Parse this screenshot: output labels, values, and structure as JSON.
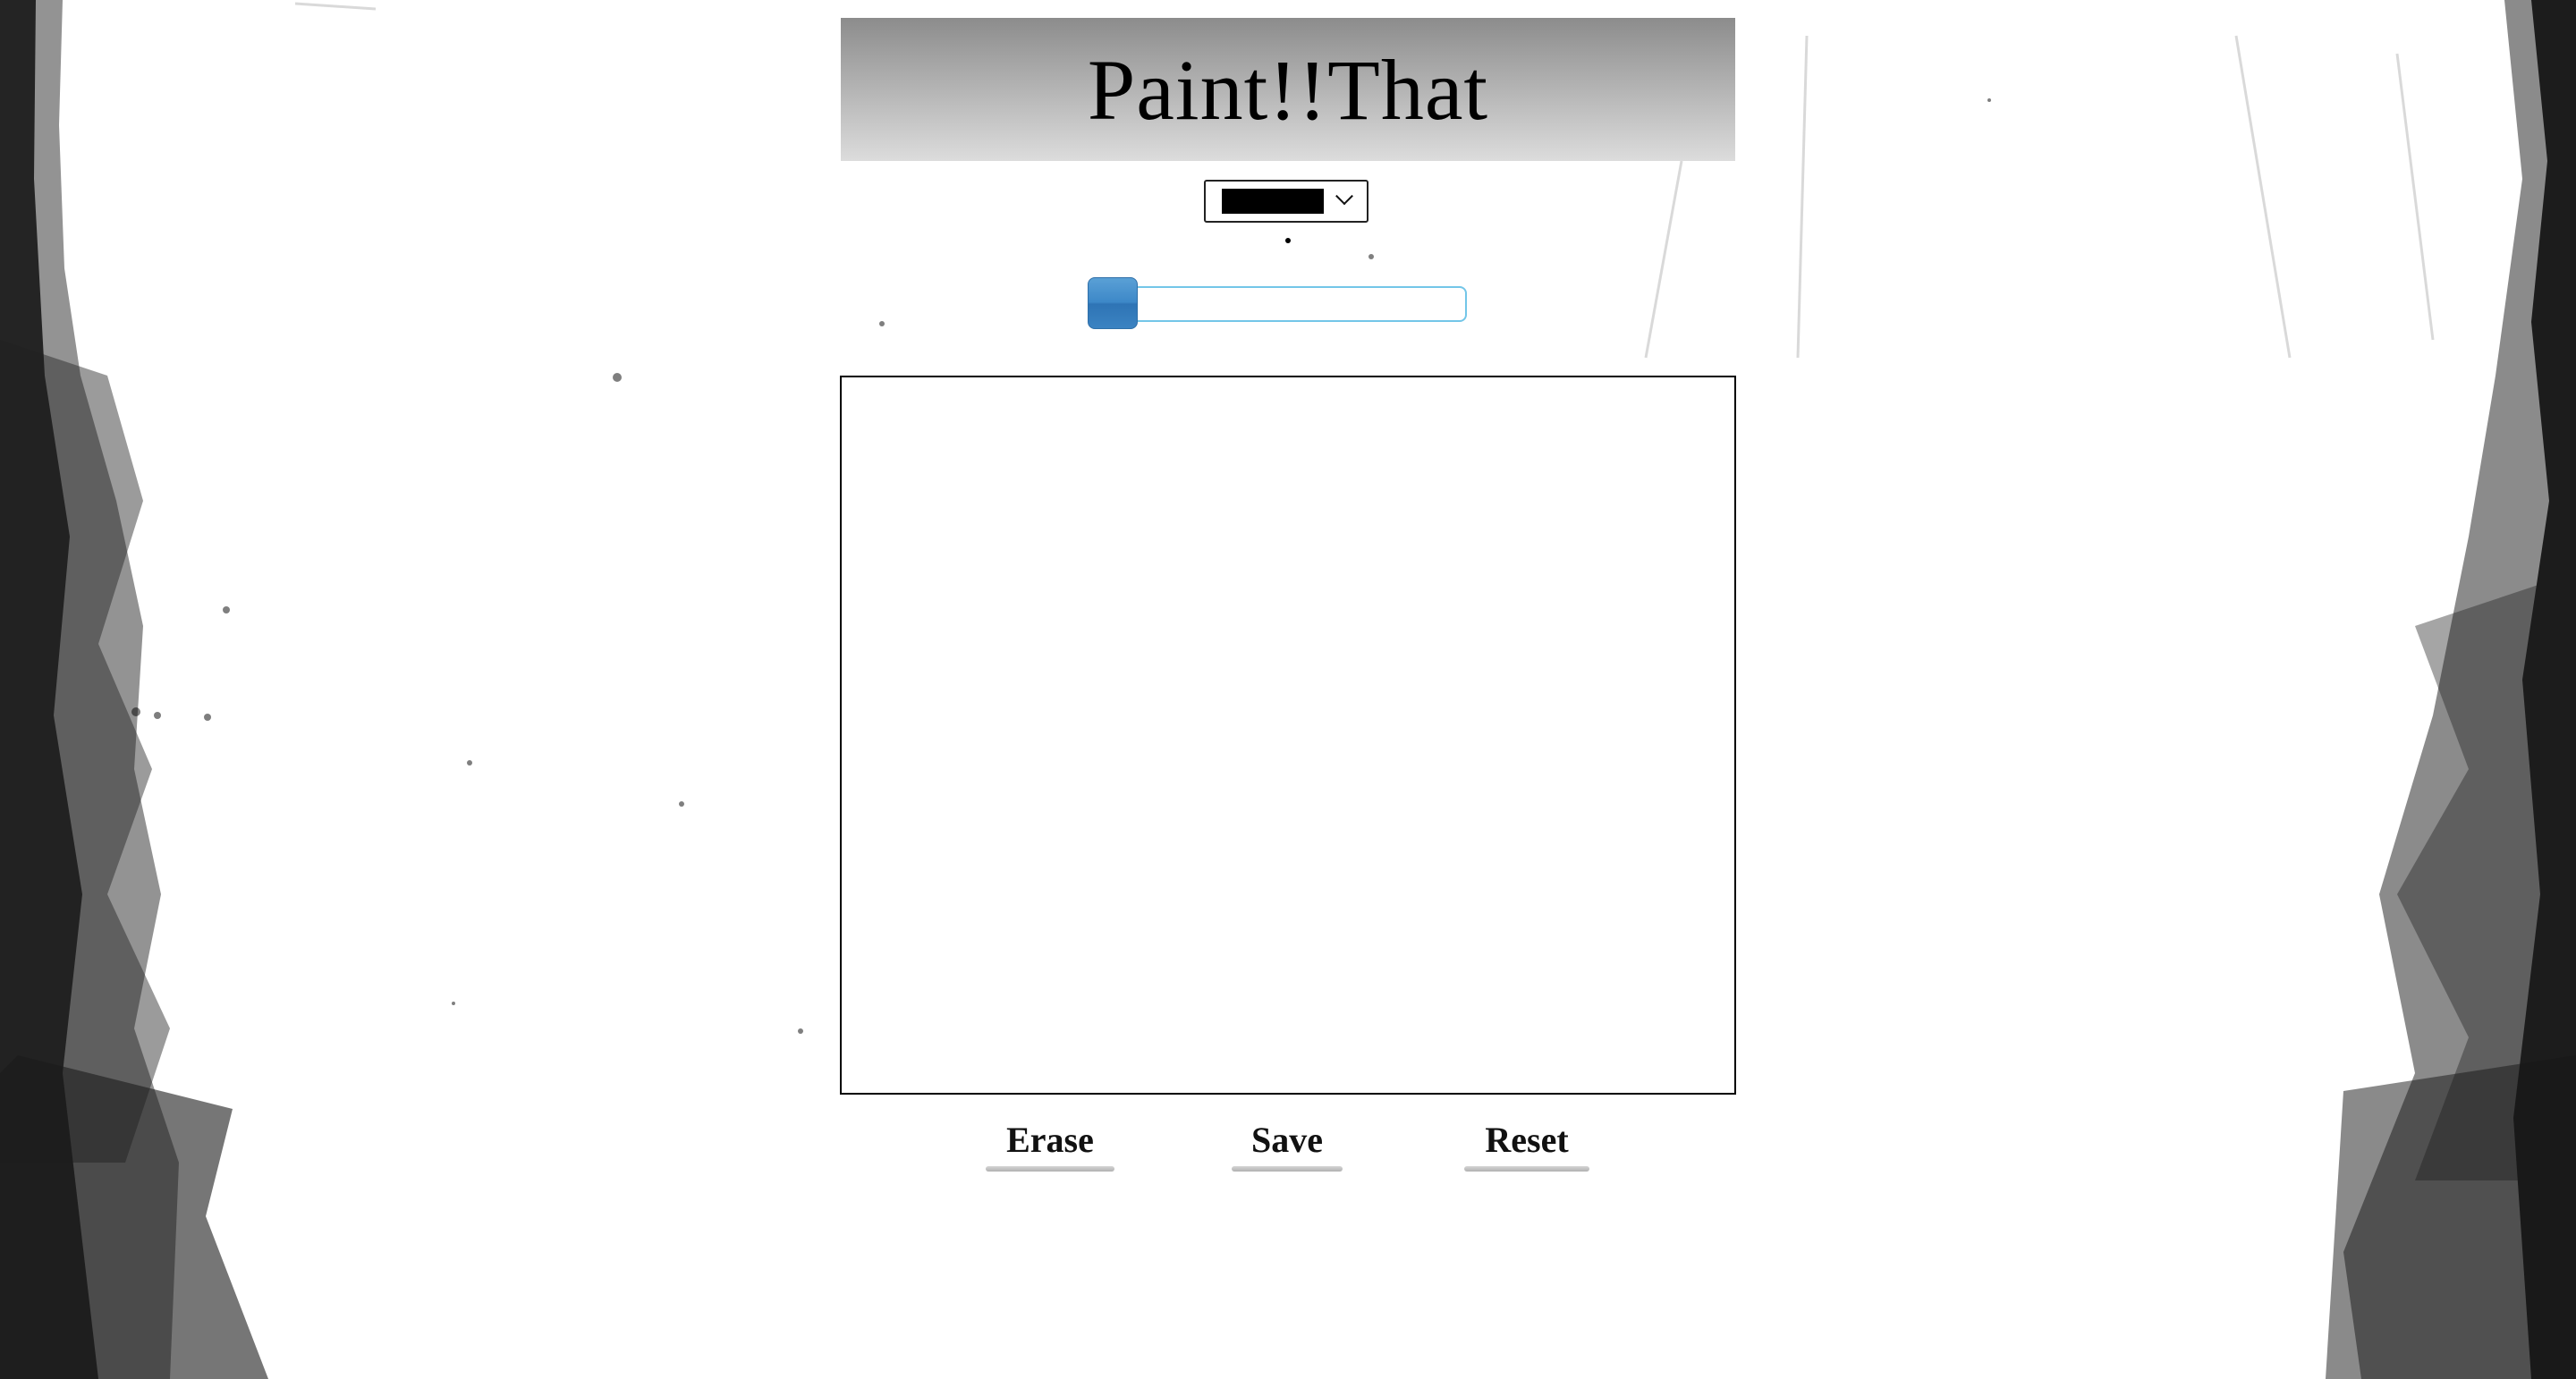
{
  "app": {
    "title": "Paint!!That"
  },
  "color_select": {
    "selected_color": "#000000",
    "selected_label": ""
  },
  "brush_size": {
    "value_fraction": 0.0
  },
  "actions": {
    "erase_label": "Erase",
    "save_label": "Save",
    "reset_label": "Reset"
  },
  "colors": {
    "header_top": "#8c8c8c",
    "header_bottom": "#dcdcdc",
    "slider_accent": "#73c6e8",
    "slider_thumb": "#3d88c8"
  }
}
